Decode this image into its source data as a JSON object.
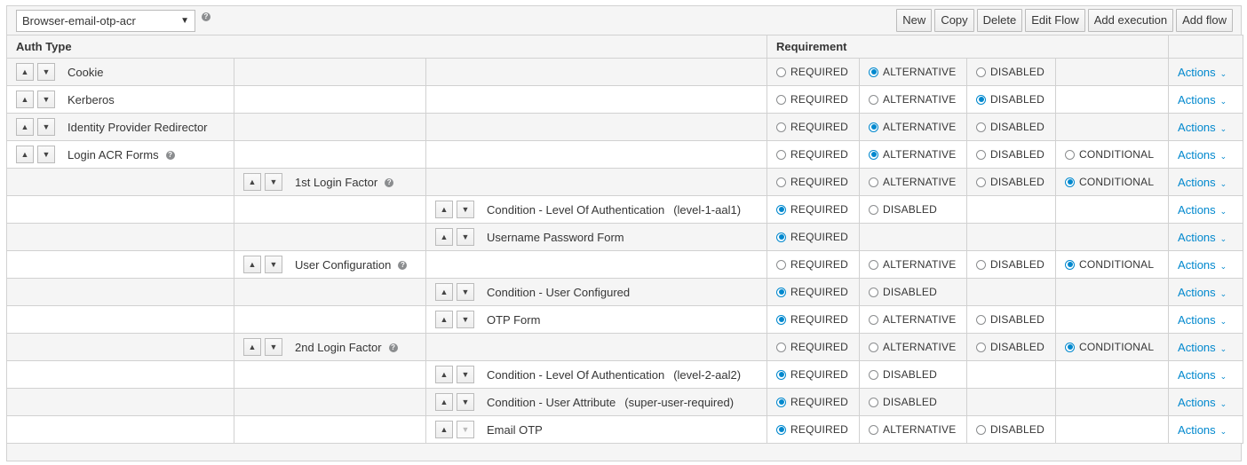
{
  "toolbar": {
    "flow_select_value": "Browser-email-otp-acr",
    "help_glyph": "?",
    "buttons": [
      "New",
      "Copy",
      "Delete",
      "Edit Flow",
      "Add execution",
      "Add flow"
    ]
  },
  "table": {
    "headers": {
      "auth_type": "Auth Type",
      "requirement": "Requirement"
    },
    "actions_label": "Actions",
    "rows": [
      {
        "level": 0,
        "name": "Cookie",
        "alias": "",
        "help": false,
        "up_disabled": false,
        "down_disabled": false,
        "options": [
          [
            "REQUIRED",
            false
          ],
          [
            "ALTERNATIVE",
            true
          ],
          [
            "DISABLED",
            false
          ]
        ]
      },
      {
        "level": 0,
        "name": "Kerberos",
        "alias": "",
        "help": false,
        "up_disabled": false,
        "down_disabled": false,
        "options": [
          [
            "REQUIRED",
            false
          ],
          [
            "ALTERNATIVE",
            false
          ],
          [
            "DISABLED",
            true
          ]
        ]
      },
      {
        "level": 0,
        "name": "Identity Provider Redirector",
        "alias": "",
        "help": false,
        "up_disabled": false,
        "down_disabled": false,
        "options": [
          [
            "REQUIRED",
            false
          ],
          [
            "ALTERNATIVE",
            true
          ],
          [
            "DISABLED",
            false
          ]
        ]
      },
      {
        "level": 0,
        "name": "Login ACR Forms",
        "alias": "",
        "help": true,
        "up_disabled": false,
        "down_disabled": false,
        "options": [
          [
            "REQUIRED",
            false
          ],
          [
            "ALTERNATIVE",
            true
          ],
          [
            "DISABLED",
            false
          ],
          [
            "CONDITIONAL",
            false
          ]
        ]
      },
      {
        "level": 1,
        "name": "1st Login Factor",
        "alias": "",
        "help": true,
        "up_disabled": false,
        "down_disabled": false,
        "options": [
          [
            "REQUIRED",
            false
          ],
          [
            "ALTERNATIVE",
            false
          ],
          [
            "DISABLED",
            false
          ],
          [
            "CONDITIONAL",
            true
          ]
        ]
      },
      {
        "level": 2,
        "name": "Condition - Level Of Authentication",
        "alias": "(level-1-aal1)",
        "help": false,
        "up_disabled": false,
        "down_disabled": false,
        "options": [
          [
            "REQUIRED",
            true
          ],
          [
            "DISABLED",
            false
          ]
        ]
      },
      {
        "level": 2,
        "name": "Username Password Form",
        "alias": "",
        "help": false,
        "up_disabled": false,
        "down_disabled": false,
        "options": [
          [
            "REQUIRED",
            true
          ]
        ]
      },
      {
        "level": 1,
        "name": "User Configuration",
        "alias": "",
        "help": true,
        "up_disabled": false,
        "down_disabled": false,
        "options": [
          [
            "REQUIRED",
            false
          ],
          [
            "ALTERNATIVE",
            false
          ],
          [
            "DISABLED",
            false
          ],
          [
            "CONDITIONAL",
            true
          ]
        ]
      },
      {
        "level": 2,
        "name": "Condition - User Configured",
        "alias": "",
        "help": false,
        "up_disabled": false,
        "down_disabled": false,
        "options": [
          [
            "REQUIRED",
            true
          ],
          [
            "DISABLED",
            false
          ]
        ]
      },
      {
        "level": 2,
        "name": "OTP Form",
        "alias": "",
        "help": false,
        "up_disabled": false,
        "down_disabled": false,
        "options": [
          [
            "REQUIRED",
            true
          ],
          [
            "ALTERNATIVE",
            false
          ],
          [
            "DISABLED",
            false
          ]
        ]
      },
      {
        "level": 1,
        "name": "2nd Login Factor",
        "alias": "",
        "help": true,
        "up_disabled": false,
        "down_disabled": false,
        "options": [
          [
            "REQUIRED",
            false
          ],
          [
            "ALTERNATIVE",
            false
          ],
          [
            "DISABLED",
            false
          ],
          [
            "CONDITIONAL",
            true
          ]
        ]
      },
      {
        "level": 2,
        "name": "Condition - Level Of Authentication",
        "alias": "(level-2-aal2)",
        "help": false,
        "up_disabled": false,
        "down_disabled": false,
        "options": [
          [
            "REQUIRED",
            true
          ],
          [
            "DISABLED",
            false
          ]
        ]
      },
      {
        "level": 2,
        "name": "Condition - User Attribute",
        "alias": "(super-user-required)",
        "help": false,
        "up_disabled": false,
        "down_disabled": false,
        "options": [
          [
            "REQUIRED",
            true
          ],
          [
            "DISABLED",
            false
          ]
        ]
      },
      {
        "level": 2,
        "name": "Email OTP",
        "alias": "",
        "help": false,
        "up_disabled": false,
        "down_disabled": true,
        "options": [
          [
            "REQUIRED",
            true
          ],
          [
            "ALTERNATIVE",
            false
          ],
          [
            "DISABLED",
            false
          ]
        ]
      }
    ]
  },
  "icons": {
    "up": "chevron-up-icon",
    "down": "chevron-down-icon",
    "help": "help-icon"
  },
  "colors": {
    "accent": "#0088ce",
    "header_bg": "#f5f5f5",
    "border": "#d1d1d1"
  }
}
